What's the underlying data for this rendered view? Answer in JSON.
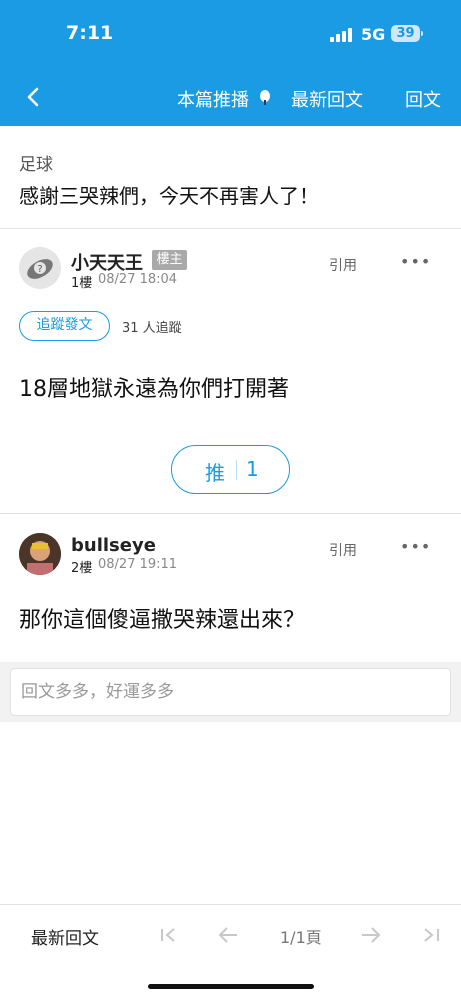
{
  "status": {
    "time": "7:11",
    "network": "5G",
    "battery": "39"
  },
  "nav": {
    "push_posts": "本篇推播",
    "latest_replies": "最新回文",
    "reply": "回文"
  },
  "thread": {
    "board": "足球",
    "title": "感謝三哭辣們，今天不再害人了！"
  },
  "posts": [
    {
      "author": "小天天王",
      "badge": "樓主",
      "floor": "1樓",
      "date": "08/27 18:04",
      "quote": "引用",
      "more": "•••",
      "follow_button": "追蹤發文",
      "follow_count": "31 人追蹤",
      "content": "18層地獄永遠為你們打開著",
      "push_label": "推",
      "push_count": "1"
    },
    {
      "author": "bullseye",
      "floor": "2樓",
      "date": "08/27 19:11",
      "quote": "引用",
      "more": "•••",
      "content": "那你這個傻逼撒哭辣還出來？"
    }
  ],
  "reply_box": {
    "placeholder": "回文多多，好運多多"
  },
  "bottom": {
    "latest_replies": "最新回文",
    "page": "1/1頁"
  },
  "icons": [
    "back-icon",
    "pin-icon",
    "signal-icon",
    "battery-icon",
    "first-page-icon",
    "prev-page-icon",
    "next-page-icon",
    "last-page-icon"
  ],
  "colors": {
    "accent": "#1a9be3",
    "badge": "#a9a9a9"
  }
}
